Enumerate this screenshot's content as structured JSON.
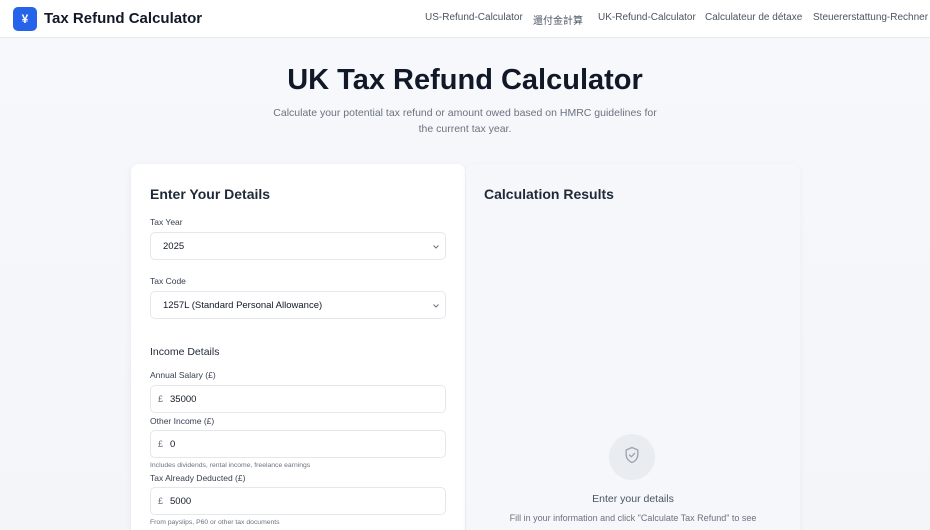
{
  "header": {
    "logo_symbol": "¥",
    "brand": "Tax Refund Calculator",
    "nav": [
      "US-Refund-Calculator",
      "還付金計算",
      "UK-Refund-Calculator",
      "Calculateur de détaxe",
      "Steuererstattung-Rechner"
    ]
  },
  "hero": {
    "title": "UK Tax Refund Calculator",
    "subtitle": "Calculate your potential tax refund or amount owed based on HMRC guidelines for the current tax year."
  },
  "form": {
    "title": "Enter Your Details",
    "tax_year_label": "Tax Year",
    "tax_year_value": "2025",
    "tax_code_label": "Tax Code",
    "tax_code_value": "1257L (Standard Personal Allowance)",
    "income_section": "Income Details",
    "salary_label": "Annual Salary (£)",
    "salary_value": "35000",
    "other_income_label": "Other Income (£)",
    "other_income_value": "0",
    "other_income_help": "Includes dividends, rental income, freelance earnings",
    "tax_deducted_label": "Tax Already Deducted (£)",
    "tax_deducted_value": "5000",
    "tax_deducted_help": "From payslips, P60 or other tax documents",
    "currency_symbol": "£"
  },
  "results": {
    "title": "Calculation Results",
    "empty_title": "Enter your details",
    "empty_text": "Fill in your information and click \"Calculate Tax Refund\" to see"
  },
  "icons": {
    "empty_state": "shield-check-icon",
    "chevron": "chevron-down-icon"
  },
  "colors": {
    "accent": "#2563eb"
  }
}
